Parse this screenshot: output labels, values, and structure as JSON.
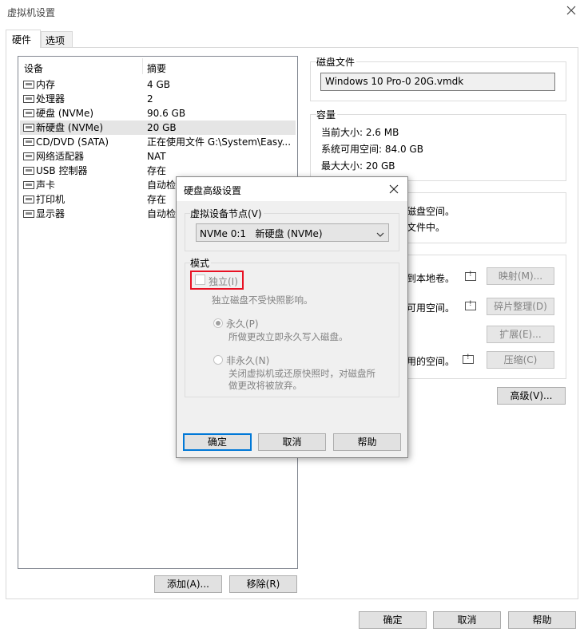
{
  "window": {
    "title": "虚拟机设置",
    "tabs": [
      {
        "label": "硬件"
      },
      {
        "label": "选项"
      }
    ]
  },
  "device_table": {
    "headers": {
      "device": "设备",
      "summary": "摘要"
    },
    "rows": [
      {
        "name": "内存",
        "summary": "4 GB",
        "icon": "memory-icon"
      },
      {
        "name": "处理器",
        "summary": "2",
        "icon": "processor-icon"
      },
      {
        "name": "硬盘 (NVMe)",
        "summary": "90.6 GB",
        "icon": "hard-disk-icon"
      },
      {
        "name": "新硬盘 (NVMe)",
        "summary": "20 GB",
        "icon": "hard-disk-icon"
      },
      {
        "name": "CD/DVD (SATA)",
        "summary": "正在使用文件 G:\\System\\Easy...",
        "icon": "cd-dvd-icon"
      },
      {
        "name": "网络适配器",
        "summary": "NAT",
        "icon": "network-icon"
      },
      {
        "name": "USB 控制器",
        "summary": "存在",
        "icon": "usb-icon"
      },
      {
        "name": "声卡",
        "summary": "自动检",
        "icon": "sound-icon"
      },
      {
        "name": "打印机",
        "summary": "存在",
        "icon": "printer-icon"
      },
      {
        "name": "显示器",
        "summary": "自动检",
        "icon": "display-icon"
      }
    ],
    "selected_index": 3
  },
  "device_buttons": {
    "add": "添加(A)...",
    "remove": "移除(R)"
  },
  "disk_file": {
    "label": "磁盘文件",
    "value": "Windows 10 Pro-0 20G.vmdk"
  },
  "capacity": {
    "label": "容量",
    "current_size": "当前大小: 2.6 MB",
    "free_space": "系统可用空间: 84.0 GB",
    "max_size": "最大大小: 20 GB"
  },
  "disk_info": {
    "line1": "磁盘空间。",
    "line2": "文件中。"
  },
  "utilities": {
    "map_text": "到本地卷。",
    "defrag_text": "可用空间。",
    "compact_text": "用的空间。",
    "map_btn": "映射(M)...",
    "defrag_btn": "碎片整理(D)",
    "expand_btn": "扩展(E)...",
    "compact_btn": "压缩(C)"
  },
  "advanced_btn": "高级(V)...",
  "footer": {
    "ok": "确定",
    "cancel": "取消",
    "help": "帮助"
  },
  "dialog": {
    "title": "硬盘高级设置",
    "node_label": "虚拟设备节点(V)",
    "node_value": "NVMe 0:1   新硬盘 (NVMe)",
    "mode_label": "模式",
    "independent": "独立(I)",
    "independent_desc": "独立磁盘不受快照影响。",
    "persistent": "永久(P)",
    "persistent_desc": "所做更改立即永久写入磁盘。",
    "nonpersistent": "非永久(N)",
    "nonpersistent_desc1": "关闭虚拟机或还原快照时，对磁盘所",
    "nonpersistent_desc2": "做更改将被放弃。",
    "ok": "确定",
    "cancel": "取消",
    "help": "帮助",
    "highlight_color": "#e81123"
  }
}
